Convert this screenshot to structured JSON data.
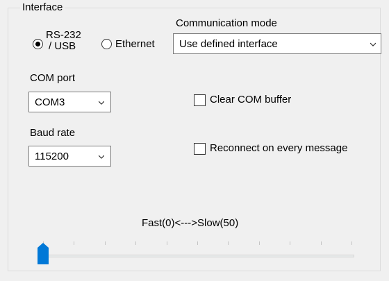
{
  "group": {
    "title": "Interface"
  },
  "interface_radio": {
    "rs232": {
      "label_line1": "RS-232",
      "label_line2": "/ USB",
      "checked": true
    },
    "ethernet": {
      "label": "Ethernet",
      "checked": false
    }
  },
  "communication_mode": {
    "label": "Communication mode",
    "value": "Use defined interface"
  },
  "com_port": {
    "label": "COM port",
    "value": "COM3"
  },
  "baud_rate": {
    "label": "Baud rate",
    "value": "115200"
  },
  "clear_com_buffer": {
    "label": "Clear COM buffer",
    "checked": false
  },
  "reconnect": {
    "label": "Reconnect on every message",
    "checked": false
  },
  "speed_slider": {
    "label": "Fast(0)<--->Slow(50)",
    "value": 0,
    "min": 0,
    "max": 50
  },
  "colors": {
    "accent": "#0078d7"
  }
}
